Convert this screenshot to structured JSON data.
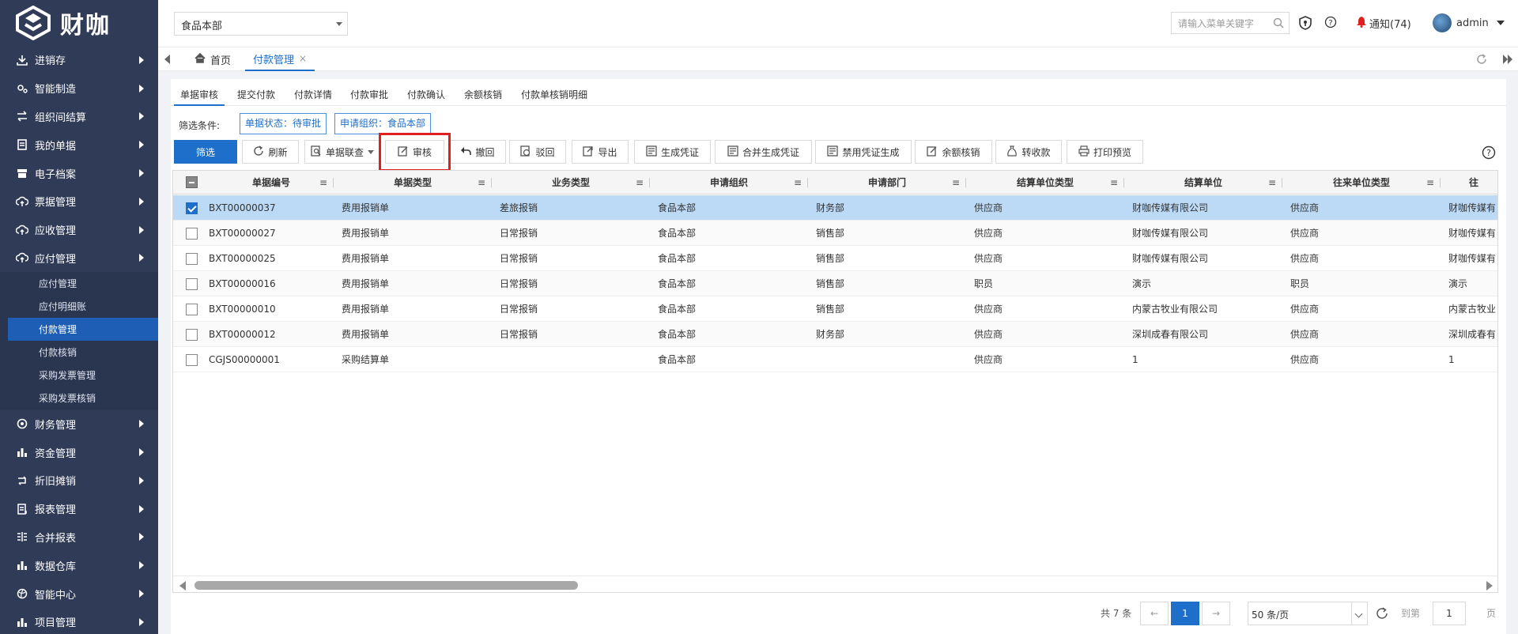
{
  "app": {
    "logo_text": "财咖"
  },
  "sidebar": {
    "items": [
      {
        "label": "进销存",
        "icon": "download-icon"
      },
      {
        "label": "智能制造",
        "icon": "gears-icon"
      },
      {
        "label": "组织间结算",
        "icon": "transfer-icon"
      },
      {
        "label": "我的单据",
        "icon": "document-icon"
      },
      {
        "label": "电子档案",
        "icon": "archive-icon"
      },
      {
        "label": "票据管理",
        "icon": "cloud-upload-icon"
      },
      {
        "label": "应收管理",
        "icon": "cloud-upload-icon"
      },
      {
        "label": "应付管理",
        "icon": "cloud-upload-icon"
      },
      {
        "label": "财务管理",
        "icon": "gear-icon"
      },
      {
        "label": "资金管理",
        "icon": "bar-chart-icon"
      },
      {
        "label": "折旧摊销",
        "icon": "cycle-icon"
      },
      {
        "label": "报表管理",
        "icon": "report-icon"
      },
      {
        "label": "合并报表",
        "icon": "merge-icon"
      },
      {
        "label": "数据仓库",
        "icon": "bar-chart-icon"
      },
      {
        "label": "智能中心",
        "icon": "globe-icon"
      },
      {
        "label": "项目管理",
        "icon": "bar-chart-icon"
      }
    ],
    "subitems": [
      "应付管理",
      "应付明细账",
      "付款管理",
      "付款核销",
      "采购发票管理",
      "采购发票核销"
    ],
    "active_sub": "付款管理"
  },
  "header": {
    "org_select": "食品本部",
    "search_placeholder": "请输入菜单关键字",
    "notice": "通知(74)",
    "user": "admin"
  },
  "tabs": [
    {
      "label": "首页",
      "icon": "home-icon"
    },
    {
      "label": "付款管理",
      "close": "×"
    }
  ],
  "subtabs": [
    "单据审核",
    "提交付款",
    "付款详情",
    "付款审批",
    "付款确认",
    "余额核销",
    "付款单核销明细"
  ],
  "filter": {
    "label": "筛选条件:",
    "chips": [
      "单据状态：待审批",
      "申请组织：食品本部"
    ]
  },
  "toolbar": {
    "filter": "筛选",
    "refresh": "刷新",
    "linked": "单据联查",
    "audit": "审核",
    "revoke": "撤回",
    "reject": "驳回",
    "export": "导出",
    "gen_voucher": "生成凭证",
    "merge_voucher": "合并生成凭证",
    "disable_voucher": "禁用凭证生成",
    "balance_writeoff": "余额核销",
    "transfer": "转收款",
    "print_preview": "打印预览"
  },
  "table": {
    "columns": [
      "单据编号",
      "单据类型",
      "业务类型",
      "申请组织",
      "申请部门",
      "结算单位类型",
      "结算单位",
      "往来单位类型",
      "往"
    ],
    "rows": [
      [
        "BXT00000037",
        "费用报销单",
        "差旅报销",
        "食品本部",
        "财务部",
        "供应商",
        "财咖传媒有限公司",
        "供应商",
        "财咖传媒有"
      ],
      [
        "BXT00000027",
        "费用报销单",
        "日常报销",
        "食品本部",
        "销售部",
        "供应商",
        "财咖传媒有限公司",
        "供应商",
        "财咖传媒有"
      ],
      [
        "BXT00000025",
        "费用报销单",
        "日常报销",
        "食品本部",
        "销售部",
        "供应商",
        "财咖传媒有限公司",
        "供应商",
        "财咖传媒有"
      ],
      [
        "BXT00000016",
        "费用报销单",
        "日常报销",
        "食品本部",
        "销售部",
        "职员",
        "演示",
        "职员",
        "演示"
      ],
      [
        "BXT00000010",
        "费用报销单",
        "日常报销",
        "食品本部",
        "销售部",
        "供应商",
        "内蒙古牧业有限公司",
        "供应商",
        "内蒙古牧业"
      ],
      [
        "BXT00000012",
        "费用报销单",
        "日常报销",
        "食品本部",
        "财务部",
        "供应商",
        "深圳成春有限公司",
        "供应商",
        "深圳成春有"
      ],
      [
        "CGJS00000001",
        "采购结算单",
        "",
        "食品本部",
        "",
        "供应商",
        "1",
        "供应商",
        "1"
      ]
    ],
    "selected_row": 0
  },
  "pagination": {
    "total": "共 7 条",
    "prev": "←",
    "current": "1",
    "next": "→",
    "page_size": "50 条/页",
    "goto_label": "到第",
    "goto_value": "1",
    "page_suffix": "页"
  },
  "colors": {
    "sidebar_bg": "#2f3b57",
    "accent": "#1e6fc9",
    "selected_row": "#bcdaf5",
    "highlight": "#e02020"
  }
}
